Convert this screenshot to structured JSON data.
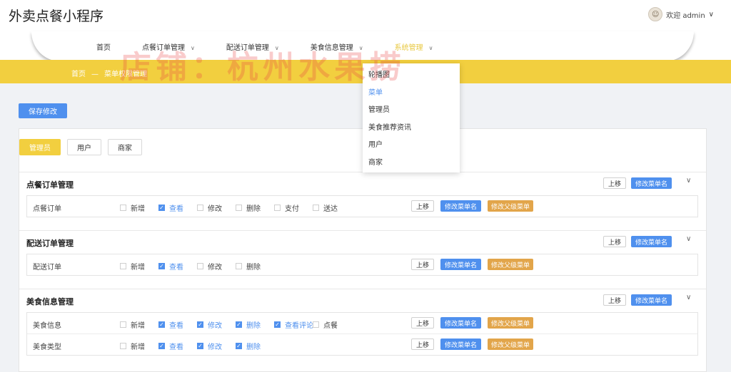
{
  "app": {
    "title": "外卖点餐小程序"
  },
  "user": {
    "greeting": "欢迎 admin",
    "chevron": "∨"
  },
  "nav": {
    "items": [
      {
        "label": "首页",
        "has_chevron": false
      },
      {
        "label": "点餐订单管理",
        "has_chevron": true
      },
      {
        "label": "配送订单管理",
        "has_chevron": true
      },
      {
        "label": "美食信息管理",
        "has_chevron": true
      },
      {
        "label": "系统管理",
        "has_chevron": true,
        "active": true
      }
    ]
  },
  "breadcrumb": {
    "home": "首页",
    "separator": "—",
    "current": "菜单权限管理"
  },
  "watermark": "店铺：杭州水果捞",
  "toolbar": {
    "save_label": "保存修改"
  },
  "role_tabs": [
    {
      "label": "管理员",
      "active": true
    },
    {
      "label": "用户",
      "active": false
    },
    {
      "label": "商家",
      "active": false
    }
  ],
  "actions": {
    "move_up": "上移",
    "rename": "修改菜单名",
    "rename_parent": "修改父级菜单"
  },
  "groups": [
    {
      "title": "点餐订单管理",
      "rows": [
        {
          "name": "点餐订单",
          "perms": [
            {
              "label": "新增",
              "checked": false
            },
            {
              "label": "查看",
              "checked": true
            },
            {
              "label": "修改",
              "checked": false
            },
            {
              "label": "删除",
              "checked": false
            },
            {
              "label": "支付",
              "checked": false
            },
            {
              "label": "送达",
              "checked": false
            }
          ]
        }
      ]
    },
    {
      "title": "配送订单管理",
      "rows": [
        {
          "name": "配送订单",
          "perms": [
            {
              "label": "新增",
              "checked": false
            },
            {
              "label": "查看",
              "checked": true
            },
            {
              "label": "修改",
              "checked": false
            },
            {
              "label": "删除",
              "checked": false
            }
          ]
        }
      ]
    },
    {
      "title": "美食信息管理",
      "rows": [
        {
          "name": "美食信息",
          "perms": [
            {
              "label": "新增",
              "checked": false
            },
            {
              "label": "查看",
              "checked": true
            },
            {
              "label": "修改",
              "checked": true
            },
            {
              "label": "删除",
              "checked": true
            },
            {
              "label": "查看评论",
              "checked": true
            },
            {
              "label": "点餐",
              "checked": false
            }
          ]
        },
        {
          "name": "美食类型",
          "perms": [
            {
              "label": "新增",
              "checked": false
            },
            {
              "label": "查看",
              "checked": true
            },
            {
              "label": "修改",
              "checked": true
            },
            {
              "label": "删除",
              "checked": true
            }
          ]
        }
      ]
    }
  ],
  "dropdown": {
    "items": [
      {
        "label": "轮播图",
        "active": false
      },
      {
        "label": "菜单",
        "active": true
      },
      {
        "label": "管理员",
        "active": false
      },
      {
        "label": "美食推荐资讯",
        "active": false
      },
      {
        "label": "用户",
        "active": false
      },
      {
        "label": "商家",
        "active": false
      }
    ]
  },
  "colors": {
    "accent": "#4f90ee",
    "banner": "#f2cf3f",
    "parent_button": "#e2a54a",
    "active_nav": "#e8c840"
  }
}
